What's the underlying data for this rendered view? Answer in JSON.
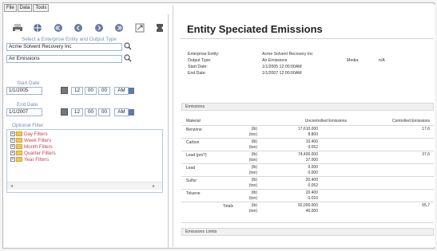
{
  "menu": {
    "tabs": [
      "File",
      "Data",
      "Tools"
    ]
  },
  "toolbar": {
    "icons": [
      "print-icon",
      "globe-icon",
      "first-page-icon",
      "prev-page-icon",
      "next-page-icon",
      "last-page-icon",
      "export-icon",
      "settings-icon"
    ]
  },
  "selection": {
    "label": "Select a Enterprise Entity and Output Type",
    "entity_value": "Acme Solvent Recovery Inc",
    "output_value": "Air Emissions"
  },
  "start": {
    "label": "Start Date",
    "date": "1/1/2005",
    "hour": "12",
    "minute": "00",
    "second": "00",
    "ampm": "AM"
  },
  "end": {
    "label": "End Date",
    "date": "1/1/2007",
    "hour": "12",
    "minute": "00",
    "second": "00",
    "ampm": "AM"
  },
  "filters": {
    "label": "Optional Filter",
    "items": [
      "Day Filters",
      "Week Filters",
      "Month Filters",
      "Quarter Filters",
      "Year Filters"
    ]
  },
  "report": {
    "title": "Entity Speciated Emissions",
    "meta": {
      "entity_label": "Enterprise Entity:",
      "entity_value": "Acme Solvent Recovery Inc",
      "output_label": "Output Type:",
      "output_value": "Air Emissions",
      "media_label": "Media:",
      "media_value": "n/A",
      "start_label": "Start Date:",
      "start_value": "1/1/2005  12:00:00AM",
      "end_label": "End Date:",
      "end_value": "1/1/2007  12:00:00AM"
    },
    "emissions_band": "Emissions",
    "limits_band": "Emissions Limits",
    "table": {
      "headers": [
        "Material",
        "Uncontrolled Emissions",
        "Controlled Emissions"
      ],
      "rows": [
        {
          "name": "Benzene",
          "units": [
            "(lb)",
            "(ton)"
          ],
          "uncontrolled": [
            "17,610.000",
            "8.800"
          ],
          "controlled": [
            "17,6",
            ""
          ]
        },
        {
          "name": "Carbon",
          "units": [
            "(lb)",
            "(ton)"
          ],
          "uncontrolled": [
            "10.400",
            "0.052"
          ],
          "controlled": [
            "",
            ""
          ]
        },
        {
          "name": "Lead (pm?)",
          "units": [
            "(lb)",
            "(ton)"
          ],
          "uncontrolled": [
            "74,400.000",
            "37.000"
          ],
          "controlled": [
            "37,6",
            ""
          ]
        },
        {
          "name": "Lead",
          "units": [
            "(lb)",
            "(ton)"
          ],
          "uncontrolled": [
            "0.000",
            "0.000"
          ],
          "controlled": [
            "",
            ""
          ]
        },
        {
          "name": "Sulfur",
          "units": [
            "(lb)",
            "(ton)"
          ],
          "uncontrolled": [
            "20.400",
            "0.052"
          ],
          "controlled": [
            "",
            ""
          ]
        },
        {
          "name": "Toluene",
          "units": [
            "(lb)",
            "(ton)"
          ],
          "uncontrolled": [
            "20.400",
            "0.010"
          ],
          "controlled": [
            "",
            ""
          ]
        }
      ],
      "total": {
        "label": "Totals",
        "units": [
          "(lb)",
          "(ton)"
        ],
        "uncontrolled": [
          "92,000.000",
          "46.000"
        ],
        "controlled": [
          "55,7",
          ""
        ]
      }
    }
  },
  "colors": {
    "accent": "#7a8fb4",
    "field_border": "#9fb1d1",
    "tree_text": "#c04a4a",
    "folder": "#f0c85a"
  }
}
